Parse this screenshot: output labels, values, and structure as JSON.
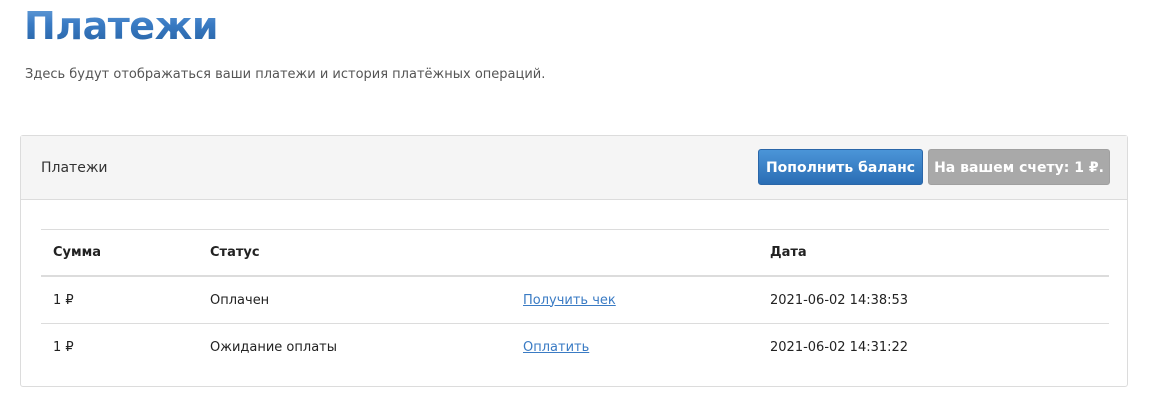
{
  "page": {
    "title": "Платежи",
    "subtitle": "Здесь будут отображаться ваши платежи и история платёжных операций."
  },
  "panel": {
    "title": "Платежи",
    "topup_label": "Пополнить баланс",
    "balance_label": "На вашем счету: 1 ₽."
  },
  "table": {
    "headers": {
      "sum": "Сумма",
      "status": "Статус",
      "action": "",
      "date": "Дата"
    },
    "rows": [
      {
        "sum": "1 ₽",
        "status": "Оплачен",
        "action": "Получить чек",
        "date": "2021-06-02 14:38:53"
      },
      {
        "sum": "1 ₽",
        "status": "Ожидание оплаты",
        "action": "Оплатить",
        "date": "2021-06-02 14:31:22"
      }
    ]
  },
  "colors": {
    "title_gradient_top": "#6fa6dc",
    "title_gradient_bottom": "#235f9f",
    "primary_button": "#2a6db4",
    "balance_badge": "#a9a9a9",
    "link": "#3a7bc4"
  }
}
